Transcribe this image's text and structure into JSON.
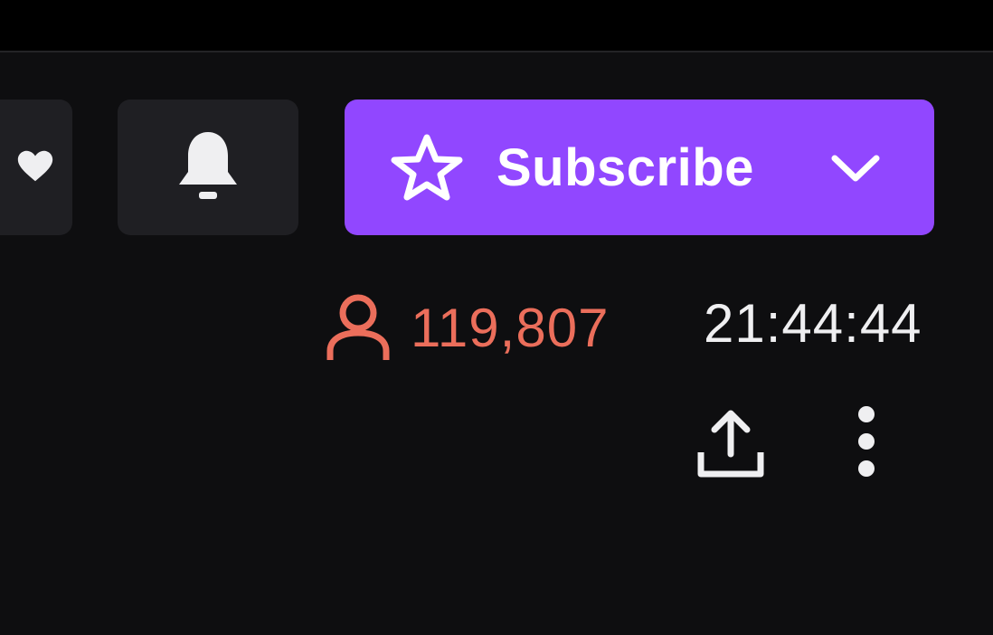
{
  "header": {
    "partial_button_icon": "heart-icon",
    "notifications_icon": "bell-icon"
  },
  "subscribe": {
    "label": "Subscribe",
    "star_icon": "star-outline-icon",
    "dropdown_icon": "chevron-down-icon",
    "color": "#9147ff"
  },
  "stream_info": {
    "viewer_icon": "person-icon",
    "viewer_count": "119,807",
    "viewer_color": "#eb6e5b",
    "uptime": "21:44:44"
  },
  "actions": {
    "share_icon": "share-upload-icon",
    "more_icon": "more-vertical-icon"
  }
}
